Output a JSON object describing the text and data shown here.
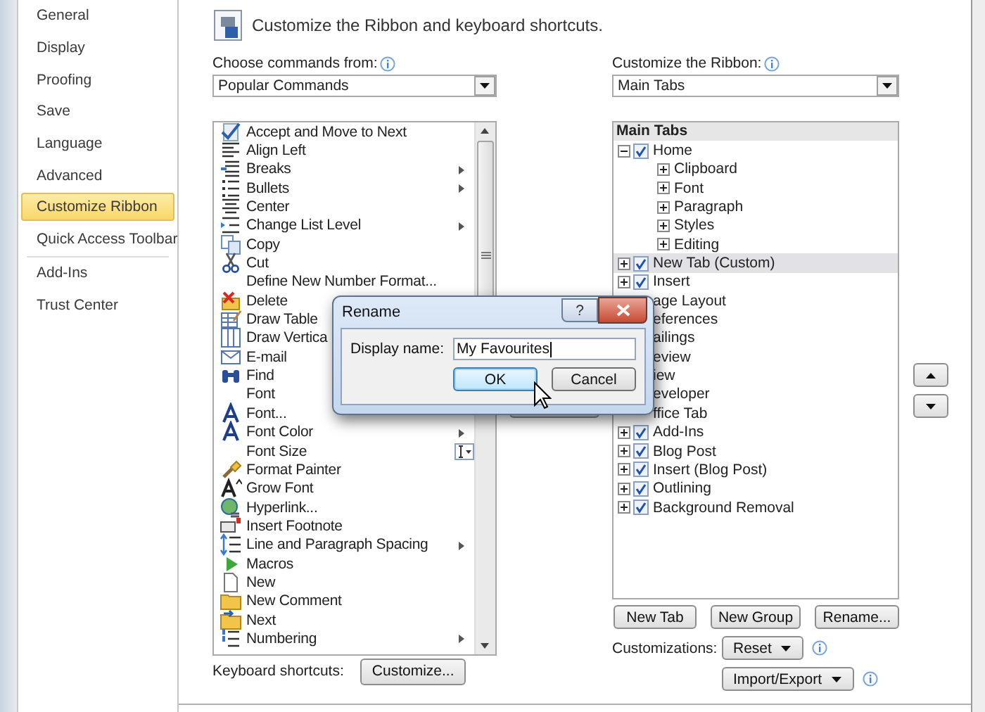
{
  "header": {
    "title": "Customize the Ribbon and keyboard shortcuts."
  },
  "sidebar": {
    "groups": [
      [
        {
          "label": "General",
          "selected": false
        },
        {
          "label": "Display",
          "selected": false
        },
        {
          "label": "Proofing",
          "selected": false
        },
        {
          "label": "Save",
          "selected": false
        },
        {
          "label": "Language",
          "selected": false
        },
        {
          "label": "Advanced",
          "selected": false
        },
        {
          "label": "Customize Ribbon",
          "selected": true
        },
        {
          "label": "Quick Access Toolbar",
          "selected": false
        }
      ],
      [
        {
          "label": "Add-Ins",
          "selected": false
        },
        {
          "label": "Trust Center",
          "selected": false
        }
      ]
    ]
  },
  "commands": {
    "label": "Choose commands from:",
    "dropdown": "Popular Commands",
    "items": [
      {
        "label": "Accept and Move to Next",
        "kind": "plain"
      },
      {
        "label": "Align Left",
        "kind": "plain"
      },
      {
        "label": "Breaks",
        "kind": "submenu"
      },
      {
        "label": "Bullets",
        "kind": "submenu"
      },
      {
        "label": "Center",
        "kind": "plain"
      },
      {
        "label": "Change List Level",
        "kind": "submenu"
      },
      {
        "label": "Copy",
        "kind": "plain"
      },
      {
        "label": "Cut",
        "kind": "plain"
      },
      {
        "label": "Define New Number Format...",
        "kind": "plain"
      },
      {
        "label": "Delete",
        "kind": "plain"
      },
      {
        "label": "Draw Table",
        "kind": "plain"
      },
      {
        "label": "Draw Vertica",
        "kind": "plain"
      },
      {
        "label": "E-mail",
        "kind": "plain"
      },
      {
        "label": "Find",
        "kind": "plain"
      },
      {
        "label": "Font",
        "kind": "plain"
      },
      {
        "label": "Font...",
        "kind": "plain"
      },
      {
        "label": "Font Color",
        "kind": "submenu"
      },
      {
        "label": "Font Size",
        "kind": "combo"
      },
      {
        "label": "Format Painter",
        "kind": "plain"
      },
      {
        "label": "Grow Font",
        "kind": "plain"
      },
      {
        "label": "Hyperlink...",
        "kind": "plain"
      },
      {
        "label": "Insert Footnote",
        "kind": "plain"
      },
      {
        "label": "Line and Paragraph Spacing",
        "kind": "submenu"
      },
      {
        "label": "Macros",
        "kind": "plain"
      },
      {
        "label": "New",
        "kind": "plain"
      },
      {
        "label": "New Comment",
        "kind": "plain"
      },
      {
        "label": "Next",
        "kind": "plain"
      },
      {
        "label": "Numbering",
        "kind": "submenu"
      }
    ],
    "shortcuts_label": "Keyboard shortcuts:",
    "customize_button": "Customize..."
  },
  "ribbon": {
    "label": "Customize the Ribbon:",
    "dropdown": "Main Tabs",
    "tree_header": "Main Tabs",
    "tree": [
      {
        "label": "Home",
        "expanded": true,
        "checked": true,
        "selected": false,
        "children": [
          {
            "label": "Clipboard",
            "expanded": false,
            "selected": false
          },
          {
            "label": "Font",
            "expanded": false,
            "selected": false
          },
          {
            "label": "Paragraph",
            "expanded": false,
            "selected": false
          },
          {
            "label": "Styles",
            "expanded": false,
            "selected": false
          },
          {
            "label": "Editing",
            "expanded": false,
            "selected": false
          }
        ]
      },
      {
        "label": "New Tab (Custom)",
        "expanded": false,
        "checked": true,
        "selected": true
      },
      {
        "label": "Insert",
        "expanded": false,
        "checked": true,
        "selected": false
      },
      {
        "label": "age Layout",
        "selected": false
      },
      {
        "label": "eferences",
        "selected": false
      },
      {
        "label": "ailings",
        "selected": false
      },
      {
        "label": "eview",
        "selected": false
      },
      {
        "label": "iew",
        "selected": false
      },
      {
        "label": "eveloper",
        "selected": false
      },
      {
        "label": "ffice Tab",
        "selected": false
      },
      {
        "label": "Add-Ins",
        "expanded": false,
        "checked": true,
        "selected": false
      },
      {
        "label": "Blog Post",
        "expanded": false,
        "checked": true,
        "selected": false
      },
      {
        "label": "Insert (Blog Post)",
        "expanded": false,
        "checked": true,
        "selected": false
      },
      {
        "label": "Outlining",
        "expanded": false,
        "checked": true,
        "selected": false
      },
      {
        "label": "Background Removal",
        "expanded": false,
        "checked": true,
        "selected": false
      }
    ],
    "buttons": [
      "New Tab",
      "New Group",
      "Rename..."
    ],
    "customizations_label": "Customizations:",
    "reset_button": "Reset",
    "import_export_button": "Import/Export"
  },
  "dialog": {
    "title": "Rename",
    "help_button": "?",
    "field_label": "Display name:",
    "value": "My Favourites",
    "ok_button": "OK",
    "cancel_button": "Cancel"
  }
}
